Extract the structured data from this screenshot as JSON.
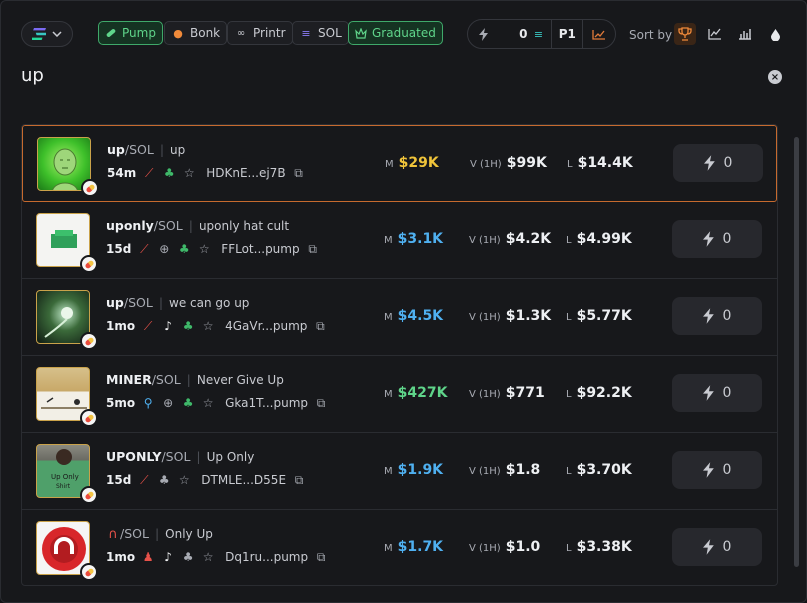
{
  "filters": {
    "chain_icon": "solana-icon",
    "pills": [
      {
        "label": "Pump",
        "active": true,
        "icon": "pill-icon"
      },
      {
        "label": "Bonk",
        "active": false,
        "icon": "fire-icon"
      },
      {
        "label": "Printr",
        "active": false,
        "icon": "printr-icon"
      },
      {
        "label": "SOL",
        "active": false,
        "icon": "solana-icon"
      },
      {
        "label": "Graduated",
        "active": true,
        "icon": "crown-icon"
      }
    ]
  },
  "quick_buy": {
    "amount": "0",
    "preset": "P1"
  },
  "sort": {
    "label": "Sort by"
  },
  "search": {
    "query": "up"
  },
  "colors": {
    "accent": "#c66a2e",
    "green": "#5fd48a",
    "blue": "#4fb0f0",
    "yellow": "#f0c43a"
  },
  "results": [
    {
      "symbol": "up",
      "pair": "/SOL",
      "name": "up",
      "age": "54m",
      "address": "HDKnE...ej7B",
      "mc_label": "M",
      "mc": "$29K",
      "mc_color": "#f0c43a",
      "vol_label": "V (1H)",
      "vol": "$99K",
      "liq_label": "L",
      "liq": "$14.4K",
      "buy": "0"
    },
    {
      "symbol": "uponly",
      "pair": "/SOL",
      "name": "uponly hat cult",
      "age": "15d",
      "address": "FFLot...pump",
      "mc_label": "M",
      "mc": "$3.1K",
      "mc_color": "#4fb0f0",
      "vol_label": "V (1H)",
      "vol": "$4.2K",
      "liq_label": "L",
      "liq": "$4.99K",
      "buy": "0"
    },
    {
      "symbol": "up",
      "pair": "/SOL",
      "name": "we can go up",
      "age": "1mo",
      "address": "4GaVr...pump",
      "mc_label": "M",
      "mc": "$4.5K",
      "mc_color": "#4fb0f0",
      "vol_label": "V (1H)",
      "vol": "$1.3K",
      "liq_label": "L",
      "liq": "$5.77K",
      "buy": "0"
    },
    {
      "symbol": "MINER",
      "pair": "/SOL",
      "name": "Never Give Up",
      "age": "5mo",
      "address": "Gka1T...pump",
      "mc_label": "M",
      "mc": "$427K",
      "mc_color": "#5fd48a",
      "vol_label": "V (1H)",
      "vol": "$771",
      "liq_label": "L",
      "liq": "$92.2K",
      "buy": "0"
    },
    {
      "symbol": "UPONLY",
      "pair": "/SOL",
      "name": "Up Only",
      "age": "15d",
      "address": "DTMLE...D55E",
      "mc_label": "M",
      "mc": "$1.9K",
      "mc_color": "#4fb0f0",
      "vol_label": "V (1H)",
      "vol": "$1.8",
      "liq_label": "L",
      "liq": "$3.70K",
      "buy": "0"
    },
    {
      "symbol": "",
      "pair": "/SOL",
      "name": "Only Up",
      "age": "1mo",
      "address": "Dq1ru...pump",
      "mc_label": "M",
      "mc": "$1.7K",
      "mc_color": "#4fb0f0",
      "vol_label": "V (1H)",
      "vol": "$1.0",
      "liq_label": "L",
      "liq": "$3.38K",
      "buy": "0"
    }
  ]
}
